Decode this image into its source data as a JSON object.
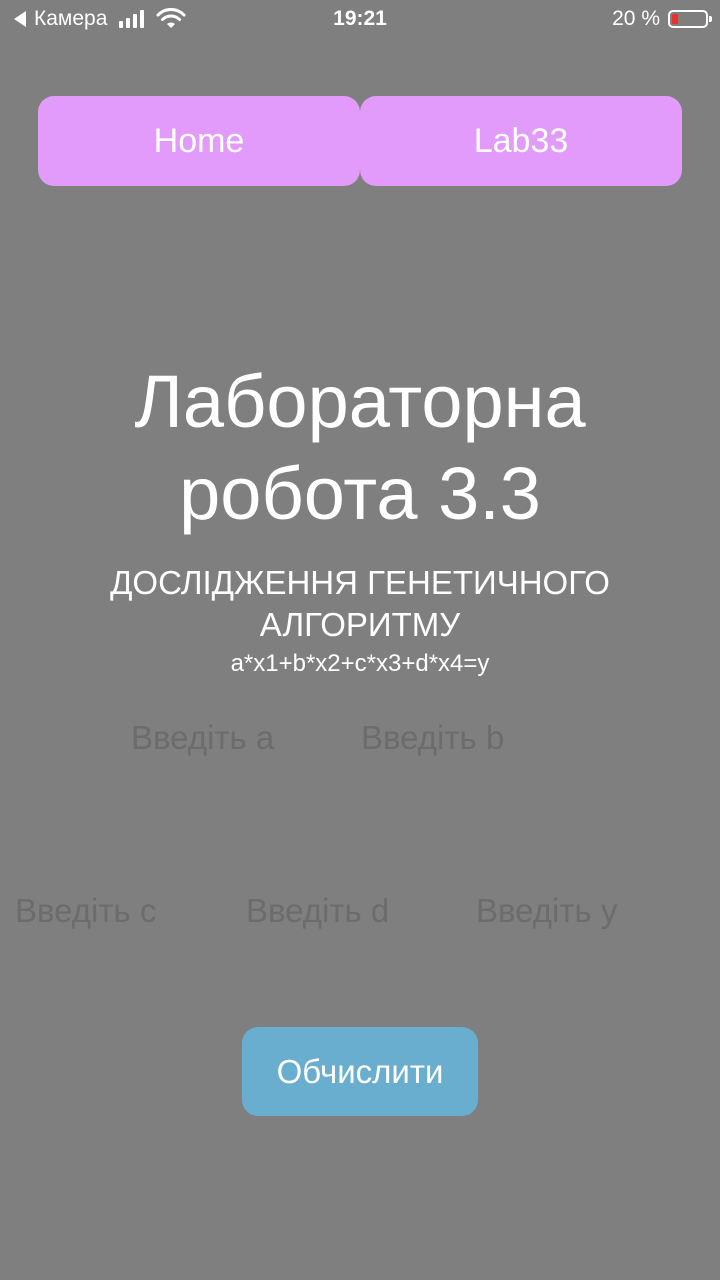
{
  "status_bar": {
    "back_app": "Камера",
    "time": "19:21",
    "battery_percent": "20 %",
    "battery_level": 0.2
  },
  "nav": {
    "home_label": "Home",
    "lab_label": "Lab33"
  },
  "main": {
    "title_line1": "Лабораторна",
    "title_line2": "робота 3.3",
    "subtitle": "ДОСЛІДЖЕННЯ ГЕНЕТИЧНОГО АЛГОРИТМУ",
    "formula": "a*x1+b*x2+c*x3+d*x4=y"
  },
  "inputs": {
    "a_placeholder": "Введіть a",
    "b_placeholder": "Введіть b",
    "c_placeholder": "Введіть c",
    "d_placeholder": "Введіть d",
    "y_placeholder": "Введіть y"
  },
  "actions": {
    "calculate_label": "Обчислити"
  },
  "colors": {
    "background": "#7f7f7f",
    "nav_button": "#e29bfa",
    "calculate_button": "#6aaecf",
    "battery_low": "#e8332a"
  }
}
